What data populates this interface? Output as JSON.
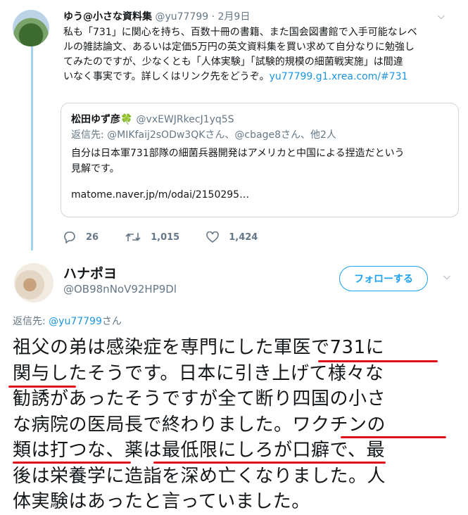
{
  "tweet1": {
    "name": "ゆう@小さな資料集",
    "handle": "@yu77799",
    "date": "· 2月9日",
    "lines": [
      "私も「731」に関心を持ち、百数十冊の書籍、また国会図書館で入手可能なレベ",
      "ルの雑誌論文、あるいは定価5万円の英文資料集を買い求めて自分なりに勉強し",
      "てみたのですが、少なくとも「人体実験」「試験的規模の細菌戦実施」は間違",
      "いなく事実です。詳しくはリンク先をどうぞ。"
    ],
    "link": "yu77799.g1.xrea.com/#731",
    "replies": "26",
    "retweets": "1,015",
    "likes": "1,424"
  },
  "quote": {
    "name": "松田ゆず彦",
    "emoji": "🍀",
    "handle": "@vxEWJRkecJ1yq5S",
    "reply_to": "返信先: @MIKfaij2sODw3QKさん、@cbage8さん、他2人",
    "line1": "自分は日本軍731部隊の細菌兵器開発はアメリカと中国による捏造だという",
    "line2": "見解です。",
    "url": "matome.naver.jp/m/odai/2150295…"
  },
  "tweet2": {
    "name": "ハナポヨ",
    "handle": "@OB98nNoV92HP9Dl",
    "follow_label": "フォローする",
    "reply_prefix": "返信先: ",
    "reply_handle": "@yu77799",
    "reply_suffix": "さん",
    "lines": [
      "祖父の弟は感染症を専門にした軍医で731に",
      "関与したそうです。日本に引き上げて様々な",
      "勧誘があったそうですが全て断り四国の小さ",
      "な病院の医局長で終わりました。ワクチンの",
      "類は打つな、薬は最低限にしろが口癖で、最",
      "後は栄養学に造詣を深め亡くなりました。人",
      "体実験はあったと言っていました。"
    ]
  },
  "colors": {
    "link": "#1b95e0",
    "underline": "#e0101a",
    "thread": "#a3d3f2"
  }
}
